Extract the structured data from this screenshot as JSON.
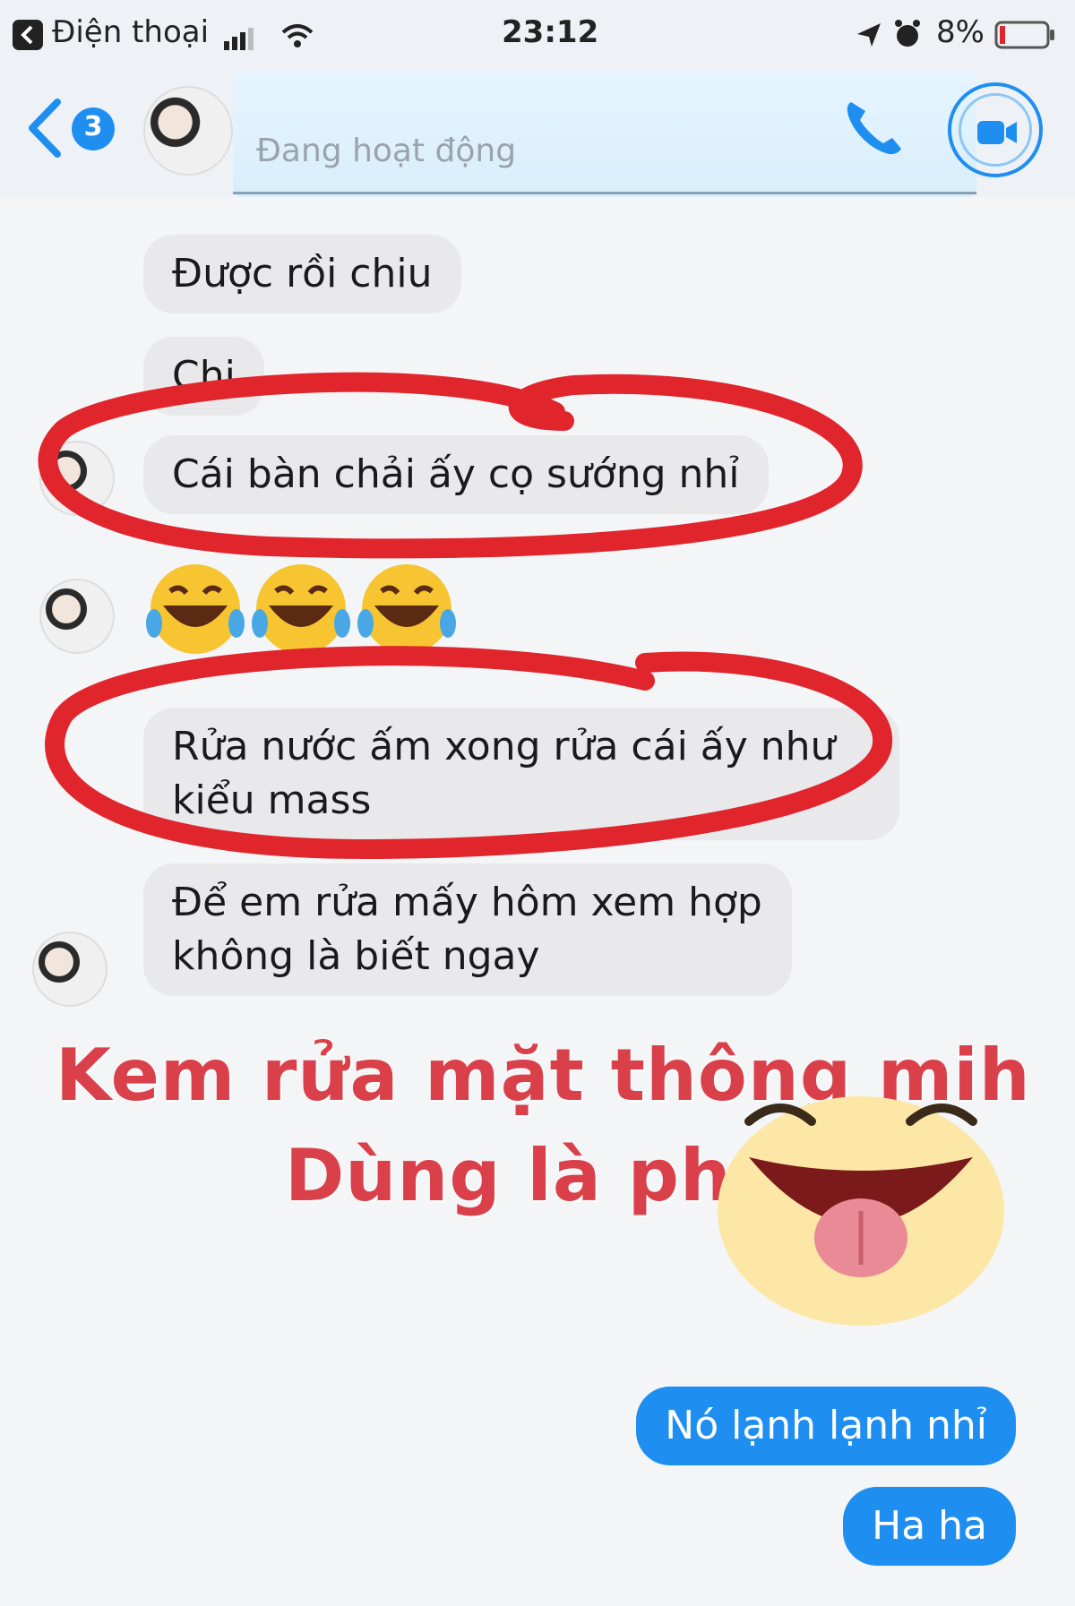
{
  "status_bar": {
    "carrier": "Điện thoại",
    "time": "23:12",
    "battery": "8%"
  },
  "header": {
    "back_count": "3",
    "contact_name": "",
    "status": "Đang hoạt động"
  },
  "messages": [
    {
      "side": "them",
      "text": "Được rồi chiu"
    },
    {
      "side": "them",
      "text": "Chi"
    },
    {
      "side": "them",
      "text": "Cái bàn chải ấy cọ sướng nhỉ"
    },
    {
      "side": "them",
      "text": "Rửa nước ấm xong rửa cái ấy như"
    },
    {
      "side": "them",
      "text": "kiểu mass"
    },
    {
      "side": "them",
      "text": "Để em rửa mấy hôm xem hợp"
    },
    {
      "side": "them",
      "text": "không là biết ngay"
    },
    {
      "side": "me",
      "text": "Nó lạnh lạnh nhỉ"
    },
    {
      "side": "me",
      "text": "Ha ha"
    }
  ],
  "overlay": {
    "line1": "Kem rửa mặt thông mih",
    "line2": "Dùng là phê"
  },
  "colors": {
    "accent": "#1f8ef1",
    "annotation": "#e0252c",
    "overlay_text": "#d9404a"
  }
}
